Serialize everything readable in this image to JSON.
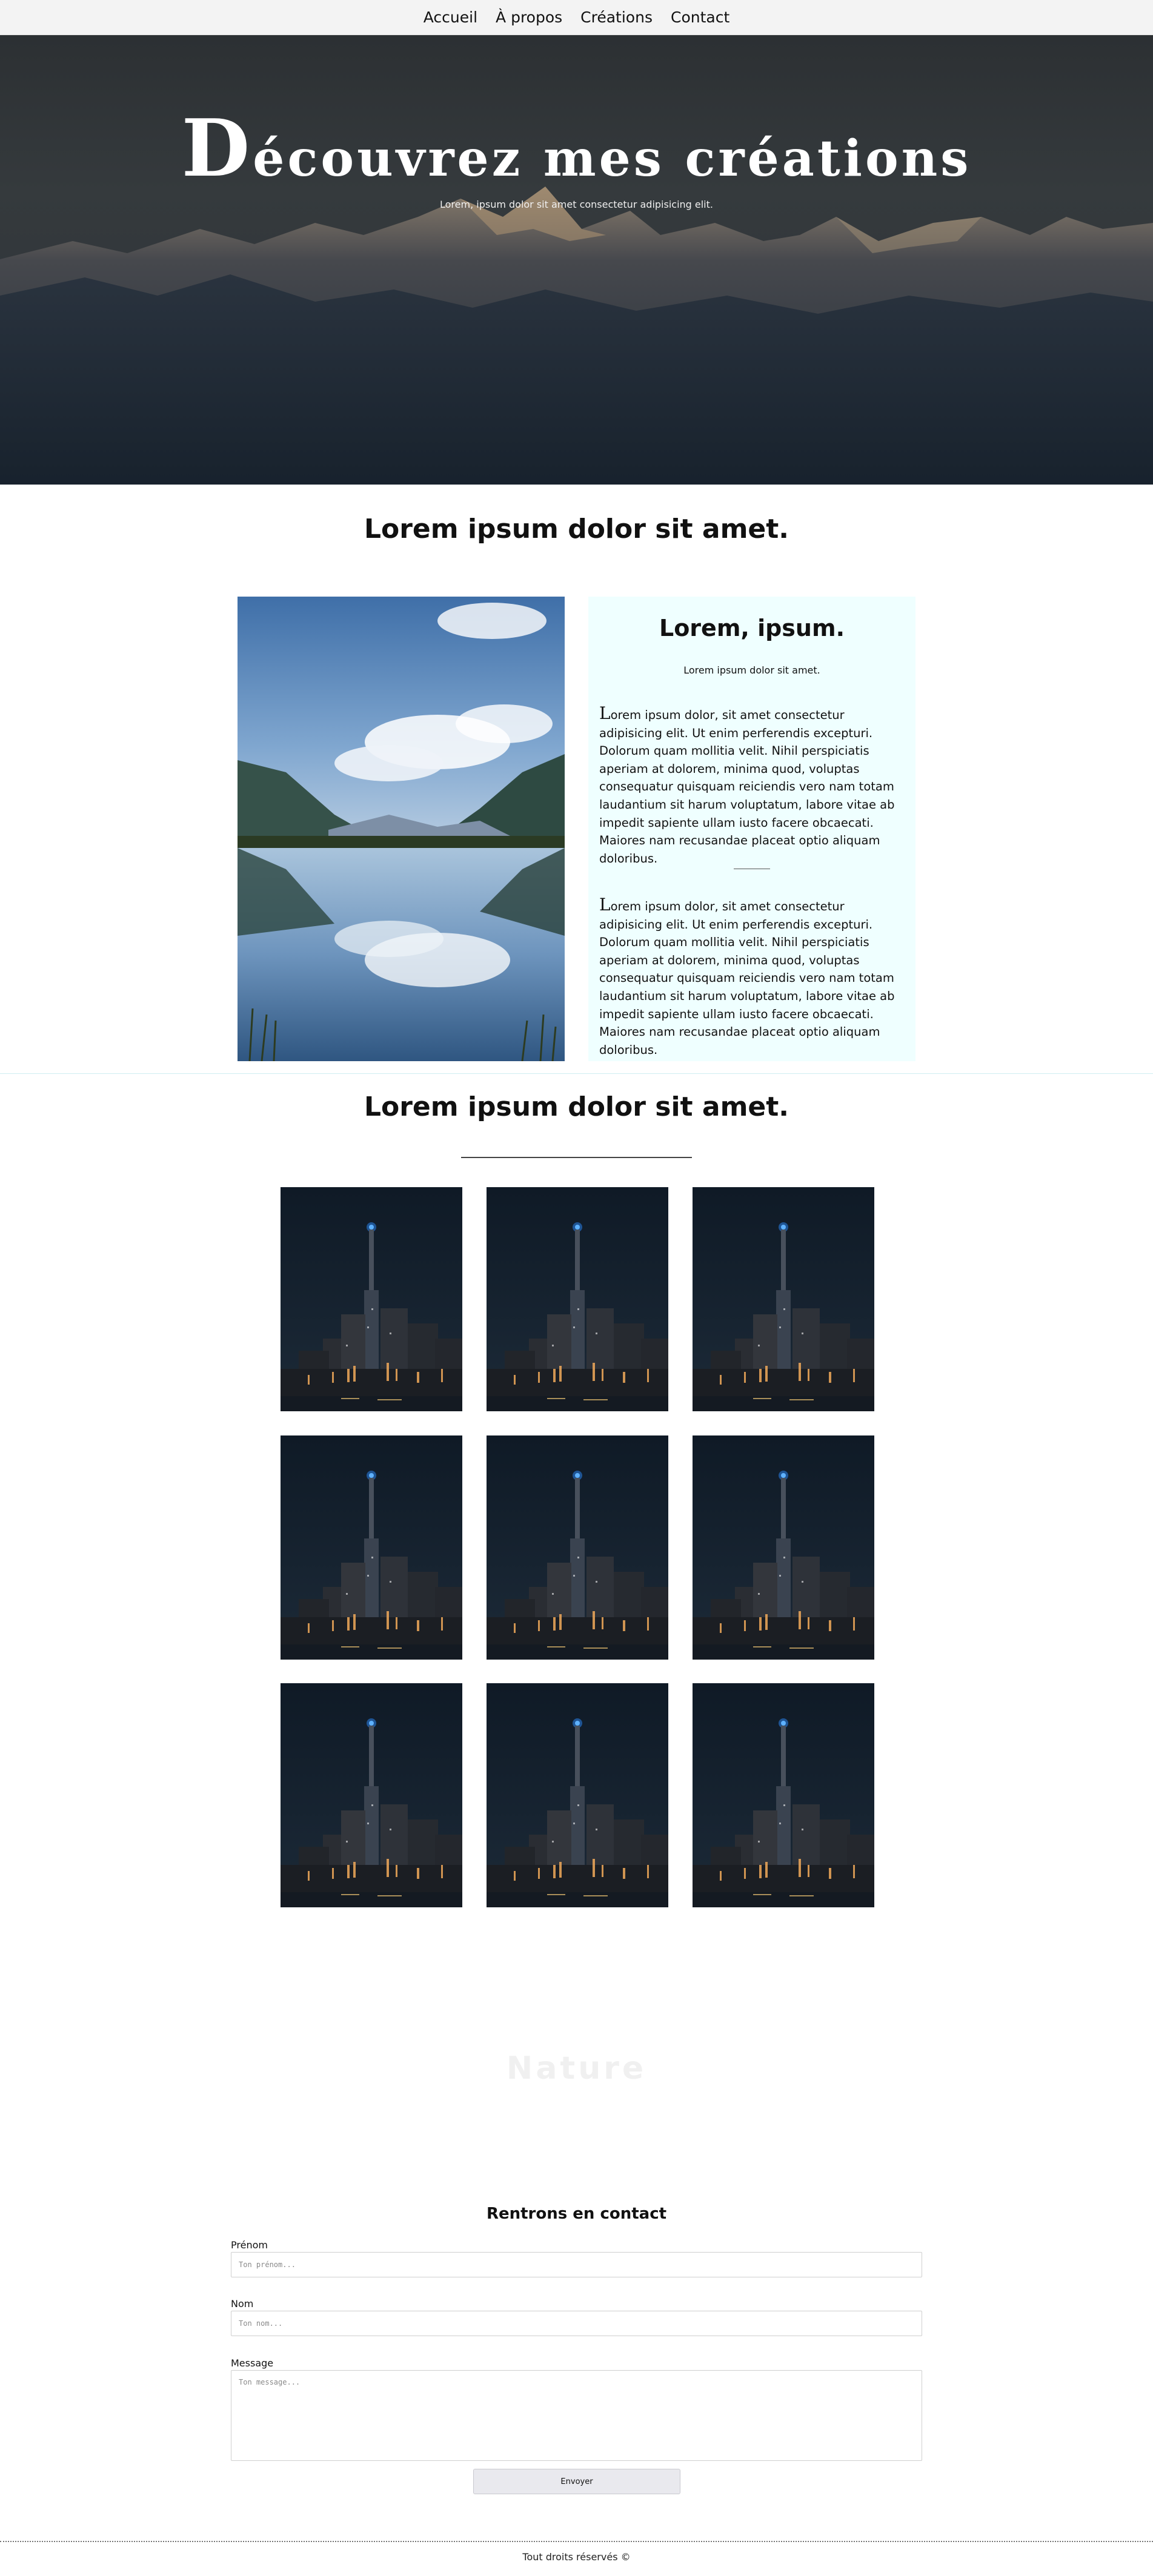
{
  "nav": {
    "items": [
      {
        "label": "Accueil"
      },
      {
        "label": "À propos"
      },
      {
        "label": "Créations"
      },
      {
        "label": "Contact"
      }
    ]
  },
  "hero": {
    "title_initial": "D",
    "title_rest": "écouvrez mes créations",
    "subtitle": "Lorem, ipsum dolor sit amet consectetur adipisicing elit."
  },
  "about": {
    "title": "Lorem ipsum dolor sit amet.",
    "card": {
      "title": "Lorem, ipsum.",
      "subtitle": "Lorem ipsum dolor sit amet.",
      "p1_initial": "L",
      "p1_rest": "orem ipsum dolor, sit amet consectetur adipisicing elit. Ut enim perferendis excepturi. Dolorum quam mollitia velit. Nihil perspiciatis aperiam at dolorem, minima quod, voluptas consequatur quisquam reiciendis vero nam totam laudantium sit harum voluptatum, labore vitae ab impedit sapiente ullam iusto facere obcaecati. Maiores nam recusandae placeat optio aliquam doloribus.",
      "p2_initial": "L",
      "p2_rest": "orem ipsum dolor, sit amet consectetur adipisicing elit. Ut enim perferendis excepturi. Dolorum quam mollitia velit. Nihil perspiciatis aperiam at dolorem, minima quod, voluptas consequatur quisquam reiciendis vero nam totam laudantium sit harum voluptatum, labore vitae ab impedit sapiente ullam iusto facere obcaecati. Maiores nam recusandae placeat optio aliquam doloribus."
    }
  },
  "gallery": {
    "title": "Lorem ipsum dolor sit amet."
  },
  "nature": {
    "label": "Nature"
  },
  "contact": {
    "title": "Rentrons en contact",
    "firstname_label": "Prénom",
    "firstname_placeholder": "Ton prénom...",
    "lastname_label": "Nom",
    "lastname_placeholder": "Ton nom...",
    "message_label": "Message",
    "message_placeholder": "Ton message...",
    "submit_label": "Envoyer"
  },
  "footer": {
    "text": "Tout droits réservés ©"
  }
}
